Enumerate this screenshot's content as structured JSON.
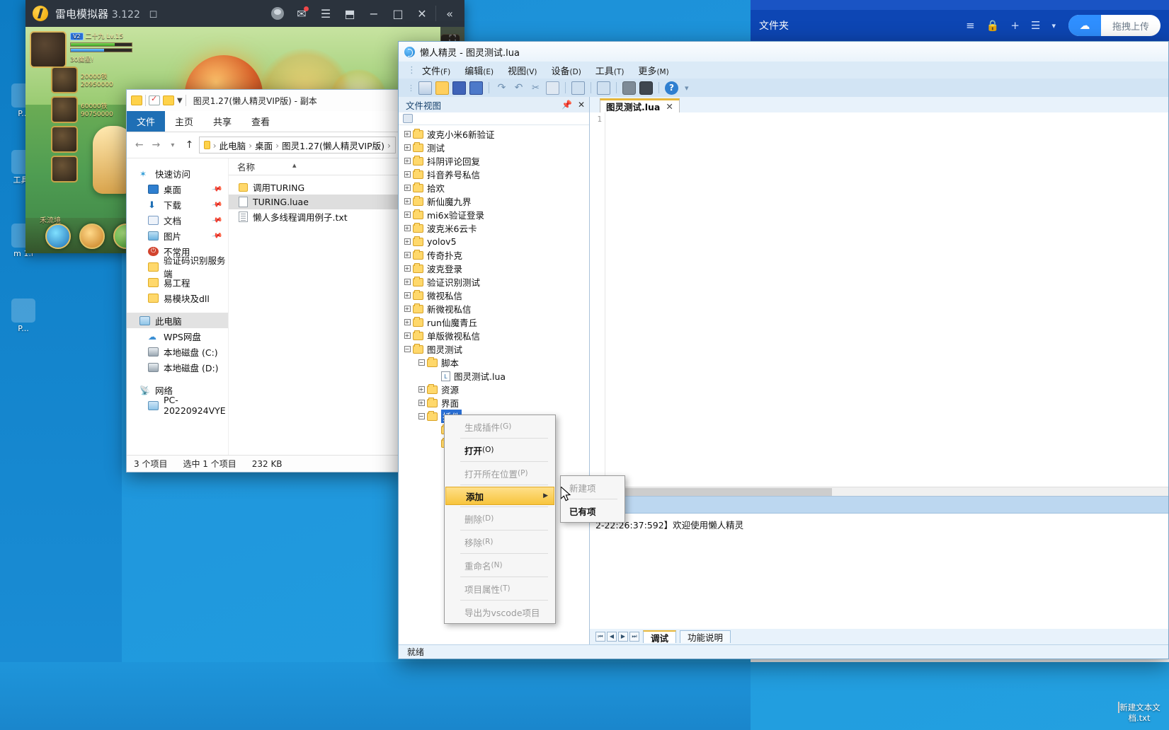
{
  "emulator": {
    "title": "雷电模拟器",
    "version": "3.122",
    "gamepad_icon": "gamepad-icon",
    "buttons": [
      "avatar-icon",
      "mail-icon",
      "menu-icon",
      "resize-icon",
      "minimize-icon",
      "maximize-icon",
      "close-icon",
      "collapse-icon"
    ],
    "hud": {
      "badge": "V2",
      "name": "二十九",
      "level": "Lv.15",
      "energy": "30魔星!",
      "stats": [
        "20000铁",
        "20950000",
        "60000铁",
        "90750000"
      ],
      "label": "禾流境"
    }
  },
  "file_explorer": {
    "title": "图灵1.27(懒人精灵VIP版) - 副本",
    "quick_access_icons": [
      "folder-icon",
      "properties-icon",
      "new-folder-icon",
      "chevron-down-icon"
    ],
    "ribbon_tabs": [
      "文件",
      "主页",
      "共享",
      "查看"
    ],
    "active_ribbon_tab": "文件",
    "nav_buttons": [
      "back-icon",
      "forward-icon",
      "recent-icon",
      "up-icon"
    ],
    "path_segments": [
      "此电脑",
      "桌面",
      "图灵1.27(懒人精灵VIP版)"
    ],
    "sidebar": [
      {
        "label": "快速访问",
        "icon": "star-icon",
        "pinned": false,
        "indent": false
      },
      {
        "label": "桌面",
        "icon": "desktop-icon",
        "pinned": true,
        "indent": true
      },
      {
        "label": "下载",
        "icon": "download-icon",
        "pinned": true,
        "indent": true
      },
      {
        "label": "文档",
        "icon": "documents-icon",
        "pinned": true,
        "indent": true
      },
      {
        "label": "图片",
        "icon": "pictures-icon",
        "pinned": true,
        "indent": true
      },
      {
        "label": "不常用",
        "icon": "red-circle-icon",
        "pinned": false,
        "indent": true
      },
      {
        "label": "验证码识别服务端",
        "icon": "folder-icon",
        "pinned": false,
        "indent": true
      },
      {
        "label": "易工程",
        "icon": "folder-icon",
        "pinned": false,
        "indent": true
      },
      {
        "label": "易模块及dll",
        "icon": "folder-icon",
        "pinned": false,
        "indent": true
      },
      {
        "label": "此电脑",
        "icon": "pc-icon",
        "pinned": false,
        "indent": false,
        "selected": true
      },
      {
        "label": "WPS网盘",
        "icon": "cloud-icon",
        "pinned": false,
        "indent": true
      },
      {
        "label": "本地磁盘 (C:)",
        "icon": "disk-icon",
        "pinned": false,
        "indent": true
      },
      {
        "label": "本地磁盘 (D:)",
        "icon": "disk-icon",
        "pinned": false,
        "indent": true
      },
      {
        "label": "网络",
        "icon": "network-icon",
        "pinned": false,
        "indent": false
      },
      {
        "label": "PC-20220924VYE",
        "icon": "pc-icon",
        "pinned": false,
        "indent": true
      }
    ],
    "column_header": "名称",
    "files": [
      {
        "name": "调用TURING",
        "icon": "folder-icon",
        "selected": false
      },
      {
        "name": "TURING.luae",
        "icon": "file-icon",
        "selected": true
      },
      {
        "name": "懒人多线程调用例子.txt",
        "icon": "text-file-icon",
        "selected": false
      }
    ],
    "status": {
      "item_count": "3 个项目",
      "selection": "选中 1 个项目",
      "size": "232 KB"
    }
  },
  "ide": {
    "title": "懒人精灵 - 图灵测试.lua",
    "logo_icon": "lazy-spirit-logo-icon",
    "menus": [
      {
        "label": "文件",
        "key": "(F)"
      },
      {
        "label": "编辑",
        "key": "(E)"
      },
      {
        "label": "视图",
        "key": "(V)"
      },
      {
        "label": "设备",
        "key": "(D)"
      },
      {
        "label": "工具",
        "key": "(T)"
      },
      {
        "label": "更多",
        "key": "(M)"
      }
    ],
    "toolbar_icons": [
      "new-file-icon",
      "open-folder-icon",
      "save-icon",
      "save-all-icon",
      "redo-icon",
      "undo-icon",
      "cut-icon",
      "copy-icon",
      "run-icon",
      "stop-icon",
      "device-icon",
      "screenshot-icon",
      "help-icon",
      "toolbar-overflow-icon"
    ],
    "left_panel": {
      "title": "文件视图",
      "pin_icon": "pin-icon",
      "close_icon": "close-icon",
      "toolbar_icon": "refresh-tree-icon"
    },
    "tree": [
      {
        "label": "波克小米6新验证",
        "depth": 0,
        "state": "collapsed",
        "type": "folder"
      },
      {
        "label": "测试",
        "depth": 0,
        "state": "collapsed",
        "type": "folder"
      },
      {
        "label": "抖阴评论回复",
        "depth": 0,
        "state": "collapsed",
        "type": "folder"
      },
      {
        "label": "抖音养号私信",
        "depth": 0,
        "state": "collapsed",
        "type": "folder"
      },
      {
        "label": "拾欢",
        "depth": 0,
        "state": "collapsed",
        "type": "folder"
      },
      {
        "label": "新仙魔九界",
        "depth": 0,
        "state": "collapsed",
        "type": "folder"
      },
      {
        "label": "mi6x验证登录",
        "depth": 0,
        "state": "collapsed",
        "type": "folder"
      },
      {
        "label": "波克米6云卡",
        "depth": 0,
        "state": "collapsed",
        "type": "folder"
      },
      {
        "label": "yolov5",
        "depth": 0,
        "state": "collapsed",
        "type": "folder"
      },
      {
        "label": "传奇扑克",
        "depth": 0,
        "state": "collapsed",
        "type": "folder"
      },
      {
        "label": "波克登录",
        "depth": 0,
        "state": "collapsed",
        "type": "folder"
      },
      {
        "label": "验证识别测试",
        "depth": 0,
        "state": "collapsed",
        "type": "folder"
      },
      {
        "label": "微视私信",
        "depth": 0,
        "state": "collapsed",
        "type": "folder"
      },
      {
        "label": "新微视私信",
        "depth": 0,
        "state": "collapsed",
        "type": "folder"
      },
      {
        "label": "run仙魔青丘",
        "depth": 0,
        "state": "collapsed",
        "type": "folder"
      },
      {
        "label": "单版微视私信",
        "depth": 0,
        "state": "collapsed",
        "type": "folder"
      },
      {
        "label": "图灵测试",
        "depth": 0,
        "state": "expanded",
        "type": "folder"
      },
      {
        "label": "脚本",
        "depth": 1,
        "state": "expanded",
        "type": "folder"
      },
      {
        "label": "图灵测试.lua",
        "depth": 2,
        "state": "leaf",
        "type": "lua"
      },
      {
        "label": "资源",
        "depth": 1,
        "state": "collapsed",
        "type": "folder"
      },
      {
        "label": "界面",
        "depth": 1,
        "state": "collapsed",
        "type": "folder"
      },
      {
        "label": "插件",
        "depth": 1,
        "state": "expanded",
        "type": "folder",
        "selected": true
      },
      {
        "label": "",
        "depth": 2,
        "state": "leaf",
        "type": "folder"
      },
      {
        "label": "",
        "depth": 2,
        "state": "leaf",
        "type": "folder"
      }
    ],
    "editor": {
      "tab_label": "图灵测试.lua",
      "tab_close_icon": "close-icon",
      "line_numbers": [
        "1"
      ],
      "code_lines": [
        ""
      ]
    },
    "log": {
      "text": "2-22:26:37:592】欢迎使用懒人精灵",
      "nav_buttons": [
        "first-page-icon",
        "prev-page-icon",
        "next-page-icon",
        "last-page-icon"
      ],
      "tabs": [
        {
          "label": "调试",
          "active": true
        },
        {
          "label": "功能说明",
          "active": false
        }
      ]
    },
    "status_text": "就绪"
  },
  "context_menu": {
    "items": [
      {
        "label": "生成插件",
        "key": "(G)",
        "state": "disabled"
      },
      {
        "label": "打开",
        "key": "(O)",
        "state": "enabled"
      },
      {
        "label": "打开所在位置",
        "key": "(P)",
        "state": "disabled"
      },
      {
        "label": "添加",
        "key": "",
        "state": "highlighted",
        "has_submenu": true
      },
      {
        "label": "删除",
        "key": "(D)",
        "state": "disabled"
      },
      {
        "label": "移除",
        "key": "(R)",
        "state": "disabled"
      },
      {
        "label": "重命名",
        "key": "(N)",
        "state": "disabled"
      },
      {
        "label": "项目属性",
        "key": "(T)",
        "state": "disabled"
      },
      {
        "label": "导出为vscode项目",
        "key": "",
        "state": "disabled"
      }
    ],
    "submenu": [
      {
        "label": "新建项",
        "state": "disabled"
      },
      {
        "label": "已有项",
        "state": "enabled"
      }
    ],
    "cursor_icon": "mouse-pointer-icon"
  },
  "upload_panel": {
    "label": "文件夹",
    "tool_icons": [
      "list-view-icon",
      "lock-icon",
      "plus-icon",
      "menu-icon",
      "chevron-down-icon"
    ],
    "cloud_icon": "baidu-cloud-icon",
    "drag_upload_label": "拖拽上传"
  },
  "desktop": {
    "file_label": "新建文本文档.txt",
    "file_icon": "text-file-icon",
    "left_icons": [
      {
        "label": "P...",
        "icon": "app-icon"
      },
      {
        "label": "工具E",
        "icon": "app-icon"
      },
      {
        "label": "m 1.l",
        "icon": "app-icon"
      },
      {
        "label": "P...",
        "icon": "app-icon"
      }
    ]
  },
  "colors": {
    "desktop_blue": "#1f8fd4",
    "ribbon_file_blue": "#1f6fb5",
    "ide_chrome": "#dbeaf7",
    "highlight_gold": "#f7c43c",
    "selection_blue": "#2a6fd4",
    "upload_blue": "#0d46b4"
  }
}
